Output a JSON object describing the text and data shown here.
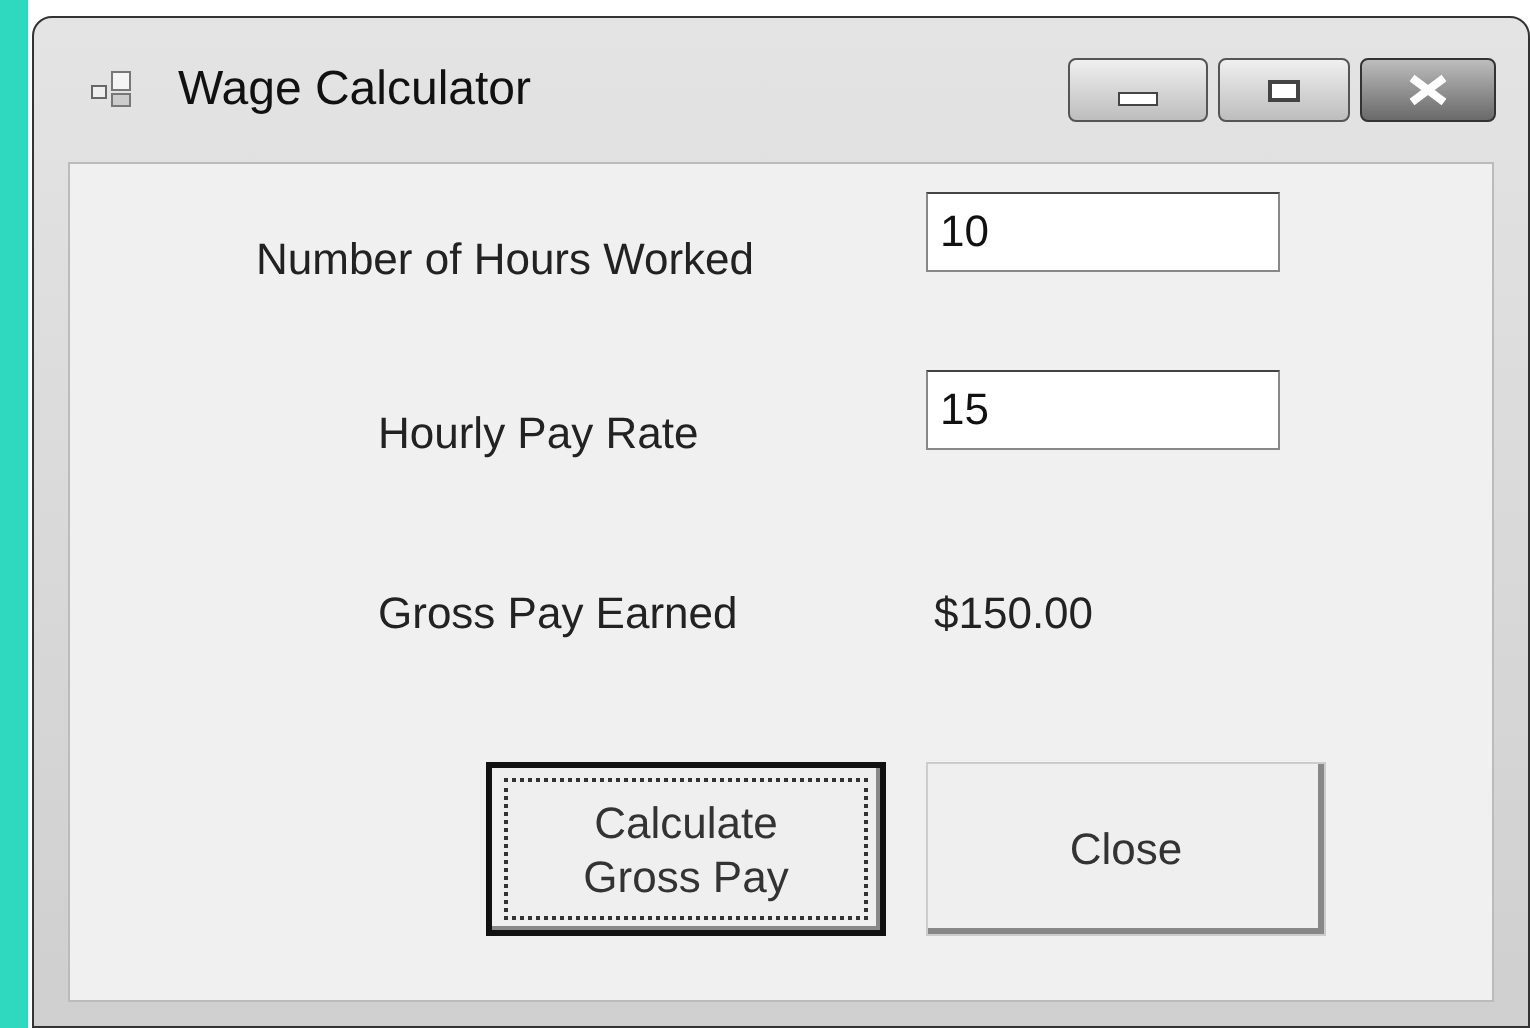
{
  "window": {
    "title": "Wage Calculator"
  },
  "fields": [
    {
      "label": "Number of Hours Worked",
      "value": "10"
    },
    {
      "label": "Hourly Pay Rate",
      "value": "15"
    }
  ],
  "result": {
    "label": "Gross Pay Earned",
    "value": "$150.00"
  },
  "buttons": [
    {
      "label": "Calculate\nGross Pay",
      "focused": true
    },
    {
      "label": "Close",
      "focused": false
    }
  ]
}
